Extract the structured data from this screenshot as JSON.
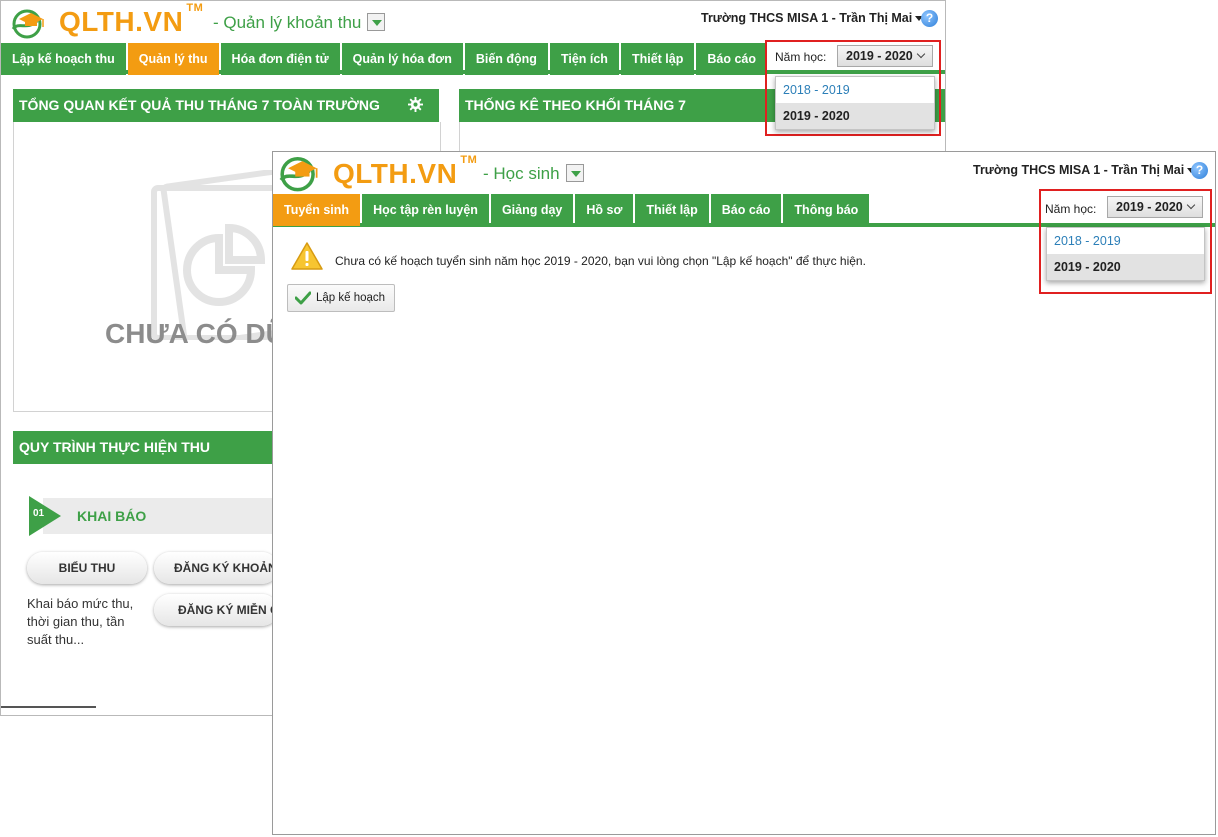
{
  "colors": {
    "brand_green": "#3ea047",
    "brand_orange": "#f39c12",
    "highlight_red": "#e02020"
  },
  "back_window": {
    "logo": "QLTH.VN",
    "logo_tm": "TM",
    "subtitle": "- Quản lý khoản thu",
    "user": "Trường THCS MISA 1  - Trần Thị Mai",
    "help_label": "?",
    "tabs": [
      {
        "label": "Lập kế hoạch thu",
        "active": false
      },
      {
        "label": "Quản lý thu",
        "active": true
      },
      {
        "label": "Hóa đơn điện tử",
        "active": false
      },
      {
        "label": "Quản lý hóa đơn",
        "active": false
      },
      {
        "label": "Biến động",
        "active": false
      },
      {
        "label": "Tiện ích",
        "active": false
      },
      {
        "label": "Thiết lập",
        "active": false
      },
      {
        "label": "Báo cáo",
        "active": false
      }
    ],
    "year_label": "Năm học:",
    "year_selected": "2019 - 2020",
    "year_options": [
      "2018 - 2019",
      "2019 - 2020"
    ],
    "panel_overview_title": "TỔNG QUAN KẾT QUẢ THU THÁNG 7 TOÀN TRƯỜNG",
    "panel_stats_title": "THỐNG KÊ THEO KHỐI THÁNG 7",
    "empty_text": "CHƯA CÓ DỮ",
    "process_title": "QUY TRÌNH THỰC HIỆN THU",
    "step_number": "01",
    "step_title": "KHAI BÁO",
    "btn_bieu_thu": "BIỂU THU",
    "btn_dang_ky_khoan": "ĐĂNG KÝ KHOẢN",
    "btn_dang_ky_mien": "ĐĂNG KÝ MIỄN G",
    "step_description": "Khai báo mức thu, thời gian thu, tần suất thu..."
  },
  "front_window": {
    "logo": "QLTH.VN",
    "logo_tm": "TM",
    "subtitle": "- Học sinh",
    "user": "Trường THCS MISA 1  - Trần Thị Mai",
    "help_label": "?",
    "tabs": [
      {
        "label": "Tuyển sinh",
        "active": true
      },
      {
        "label": "Học tập rèn luyện",
        "active": false
      },
      {
        "label": "Giảng dạy",
        "active": false
      },
      {
        "label": "Hồ sơ",
        "active": false
      },
      {
        "label": "Thiết lập",
        "active": false
      },
      {
        "label": "Báo cáo",
        "active": false
      },
      {
        "label": "Thông báo",
        "active": false
      }
    ],
    "year_label": "Năm học:",
    "year_selected": "2019 - 2020",
    "year_options": [
      "2018 - 2019",
      "2019 - 2020"
    ],
    "message": "Chưa có kế hoạch tuyển sinh năm học 2019 - 2020, bạn vui lòng chọn \"Lập kế hoạch\" để thực hiện.",
    "plan_button": "Lập kế hoạch"
  }
}
